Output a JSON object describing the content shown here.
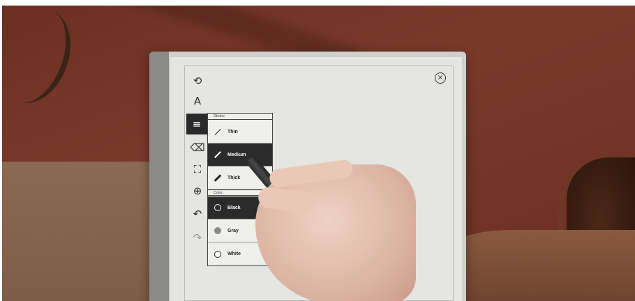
{
  "toolbar": {
    "icons": [
      {
        "name": "history-icon",
        "glyph": "⟲"
      },
      {
        "name": "text-tool-icon",
        "glyph": "A"
      },
      {
        "name": "pen-menu-icon",
        "glyph": "≡"
      },
      {
        "name": "eraser-icon",
        "glyph": "⌫"
      },
      {
        "name": "select-icon",
        "glyph": "⛶"
      },
      {
        "name": "zoom-icon",
        "glyph": "⊕"
      },
      {
        "name": "undo-icon",
        "glyph": "↶"
      },
      {
        "name": "redo-icon",
        "glyph": "↷"
      }
    ],
    "close_glyph": "×"
  },
  "menu": {
    "stroke_header": "Stroke",
    "stroke_items": [
      {
        "label": "Thin",
        "selected": false
      },
      {
        "label": "Medium",
        "selected": true
      },
      {
        "label": "Thick",
        "selected": false
      }
    ],
    "color_header": "Color",
    "color_items": [
      {
        "label": "Black",
        "swatch": "#ffffff",
        "selected": true
      },
      {
        "label": "Gray",
        "swatch": "#8a8a8a",
        "selected": false
      },
      {
        "label": "White",
        "swatch": "#ffffff",
        "selected": false
      }
    ]
  },
  "colors": {
    "panel_bg": "#efefec",
    "selected_bg": "#2b2b2b",
    "screen": "#e5e5e2"
  }
}
